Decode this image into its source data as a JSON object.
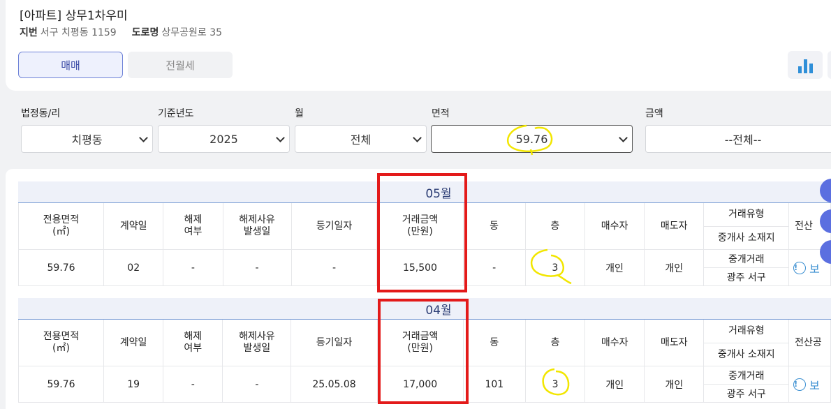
{
  "header": {
    "title": "[아파트] 상무1차우미",
    "jibun_label": "지번",
    "jibun_value": "서구 치평동 1159",
    "road_label": "도로명",
    "road_value": "상무공원로 35"
  },
  "tabs": [
    {
      "label": "매매",
      "selected": true
    },
    {
      "label": "전월세",
      "selected": false
    }
  ],
  "icons": {
    "chart": "bar-chart-icon"
  },
  "filters": [
    {
      "label": "법정동/리",
      "value": "치평동"
    },
    {
      "label": "기준년도",
      "value": "2025"
    },
    {
      "label": "월",
      "value": "전체"
    },
    {
      "label": "면적",
      "value": "59.76"
    },
    {
      "label": "금액",
      "value": "--전체--"
    }
  ],
  "table_headers": {
    "area": "전용면적",
    "area_unit": "(㎡)",
    "contract_day": "계약일",
    "cancel_1": "해제",
    "cancel_2": "여부",
    "cancel_reason_1": "해제사유",
    "cancel_reason_2": "발생일",
    "reg_date": "등기일자",
    "price_1": "거래금액",
    "price_2": "(만원)",
    "dong": "동",
    "floor": "층",
    "buyer": "매수자",
    "seller": "매도자",
    "deal_type": "거래유형",
    "agent_loc": "중개사 소재지",
    "last_col_a": "전산",
    "last_col_b": "전산공"
  },
  "groups": [
    {
      "month": "05월",
      "row": {
        "area": "59.76",
        "contract_day": "02",
        "cancel": "-",
        "cancel_date": "-",
        "reg_date": "-",
        "price": "15,500",
        "dong": "-",
        "floor": "3",
        "buyer": "개인",
        "seller": "개인",
        "deal_type": "중개거래",
        "agent_loc": "광주 서구",
        "view": "보"
      }
    },
    {
      "month": "04월",
      "row": {
        "area": "59.76",
        "contract_day": "19",
        "cancel": "-",
        "cancel_date": "-",
        "reg_date": "25.05.08",
        "price": "17,000",
        "dong": "101",
        "floor": "3",
        "buyer": "개인",
        "seller": "개인",
        "deal_type": "중개거래",
        "agent_loc": "광주 서구",
        "view": "보"
      }
    }
  ],
  "colors": {
    "accent": "#5b6fe0",
    "highlight_red": "#e31a1a",
    "highlight_yellow": "#f2e600",
    "link": "#3b8fd1"
  }
}
